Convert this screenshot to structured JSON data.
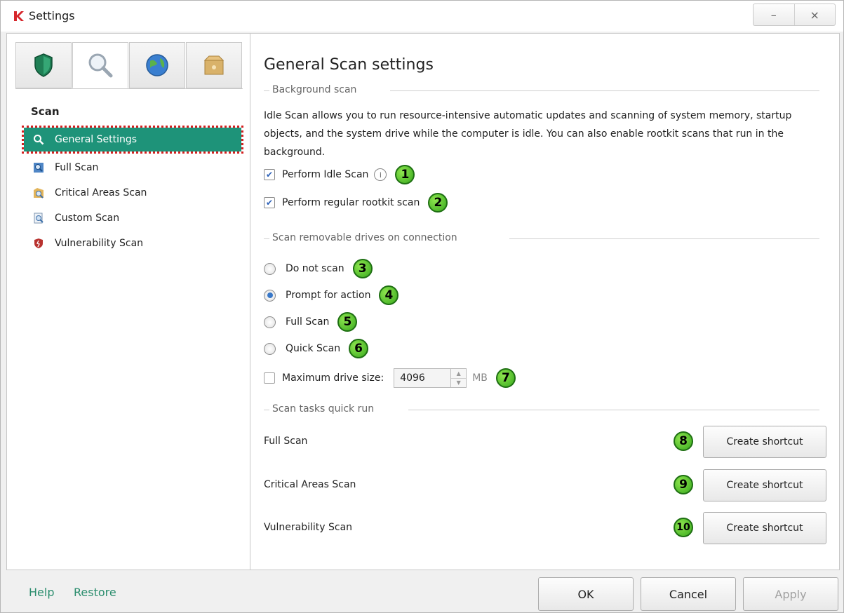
{
  "window": {
    "title": "Settings",
    "minimize": "–",
    "close": "×"
  },
  "sidebar": {
    "tabs": [
      {
        "name": "protection",
        "icon": "shield-icon"
      },
      {
        "name": "scan",
        "icon": "magnifier-icon"
      },
      {
        "name": "update",
        "icon": "globe-icon"
      },
      {
        "name": "additional",
        "icon": "box-icon"
      }
    ],
    "heading": "Scan",
    "items": [
      {
        "label": "General Settings",
        "icon": "magnifier-icon",
        "selected": true
      },
      {
        "label": "Full Scan",
        "icon": "full-scan-icon"
      },
      {
        "label": "Critical Areas Scan",
        "icon": "critical-scan-icon"
      },
      {
        "label": "Custom Scan",
        "icon": "custom-scan-icon"
      },
      {
        "label": "Vulnerability Scan",
        "icon": "vulnerability-icon"
      }
    ]
  },
  "main": {
    "title": "General Scan settings",
    "background": {
      "heading": "Background scan",
      "description": "Idle Scan allows you to run resource-intensive automatic updates and scanning of system memory, startup objects, and the system drive while the computer is idle. You can also enable rootkit scans that run in the background.",
      "idle_scan": {
        "label": "Perform Idle Scan",
        "checked": true,
        "marker": "1"
      },
      "rootkit_scan": {
        "label": "Perform regular rootkit scan",
        "checked": true,
        "marker": "2"
      }
    },
    "removable": {
      "heading": "Scan removable drives on connection",
      "options": [
        {
          "label": "Do not scan",
          "selected": false,
          "marker": "3"
        },
        {
          "label": "Prompt for action",
          "selected": true,
          "marker": "4"
        },
        {
          "label": "Full Scan",
          "selected": false,
          "marker": "5"
        },
        {
          "label": "Quick Scan",
          "selected": false,
          "marker": "6"
        }
      ],
      "max_drive": {
        "label": "Maximum drive size:",
        "checked": false,
        "value": "4096",
        "unit": "MB",
        "marker": "7"
      }
    },
    "quick_run": {
      "heading": "Scan tasks quick run",
      "tasks": [
        {
          "label": "Full Scan",
          "button": "Create shortcut",
          "marker": "8"
        },
        {
          "label": "Critical Areas Scan",
          "button": "Create shortcut",
          "marker": "9"
        },
        {
          "label": "Vulnerability Scan",
          "button": "Create shortcut",
          "marker": "10"
        }
      ]
    }
  },
  "footer": {
    "help": "Help",
    "restore": "Restore",
    "ok": "OK",
    "cancel": "Cancel",
    "apply": "Apply"
  },
  "colors": {
    "accent": "#1e9379",
    "link": "#2a8d6d",
    "marker_green": "#37a81d",
    "highlight_border": "#d42020"
  }
}
